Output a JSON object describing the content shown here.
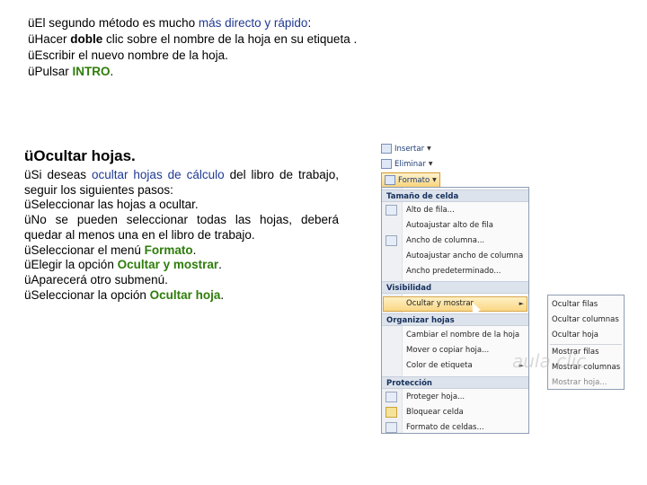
{
  "top_bullets": {
    "b1_a": "El segundo método es mucho ",
    "b1_b": "más directo y rápido",
    "b1_c": ":",
    "b2_a": "Hacer ",
    "b2_b": "doble",
    "b2_c": " clic sobre el nombre de la hoja en su etiqueta  .",
    "b3": "Escribir el nuevo nombre de la hoja.",
    "b4_a": "Pulsar ",
    "b4_b": "INTRO",
    "b4_c": "."
  },
  "bullet_glyph": "ü",
  "heading": "Ocultar hojas.",
  "body": {
    "p1_a": "Si deseas ",
    "p1_b": "ocultar hojas de cálculo",
    "p1_c": " del libro de trabajo, seguir los siguientes pasos:",
    "p2": "Seleccionar las hojas a ocultar.",
    "p3": "No se pueden seleccionar todas las hojas, deberá quedar al menos una en el libro de trabajo.",
    "p4_a": "Seleccionar el menú ",
    "p4_b": "Formato",
    "p4_c": ".",
    "p5_a": "Elegir la opción ",
    "p5_b": "Ocultar y mostrar",
    "p5_c": ".",
    "p6": "Aparecerá otro submenú.",
    "p7_a": "Seleccionar la opción ",
    "p7_b": "Ocultar hoja",
    "p7_c": "."
  },
  "menu": {
    "insert": "Insertar",
    "delete": "Eliminar",
    "format": "Formato",
    "sections": {
      "cell_size": "Tamaño de celda",
      "visibility": "Visibilidad",
      "organize": "Organizar hojas",
      "protection": "Protección"
    },
    "items": {
      "row_height": "Alto de fila...",
      "autofit_row": "Autoajustar alto de fila",
      "col_width": "Ancho de columna...",
      "autofit_col": "Autoajustar ancho de columna",
      "default_width": "Ancho predeterminado...",
      "hide_show": "Ocultar y mostrar",
      "rename": "Cambiar el nombre de la hoja",
      "move_copy": "Mover o copiar hoja...",
      "tab_color": "Color de etiqueta",
      "protect": "Proteger hoja...",
      "lock": "Bloquear celda",
      "format_cells": "Formato de celdas..."
    },
    "submenu": {
      "hide_rows": "Ocultar filas",
      "hide_cols": "Ocultar columnas",
      "hide_sheet": "Ocultar hoja",
      "show_rows": "Mostrar filas",
      "show_cols": "Mostrar columnas",
      "show_sheet": "Mostrar hoja..."
    },
    "watermark": "aula clic"
  },
  "colors": {
    "blue_emphasis": "#1f3a93",
    "green_emphasis": "#2e7d0a"
  }
}
